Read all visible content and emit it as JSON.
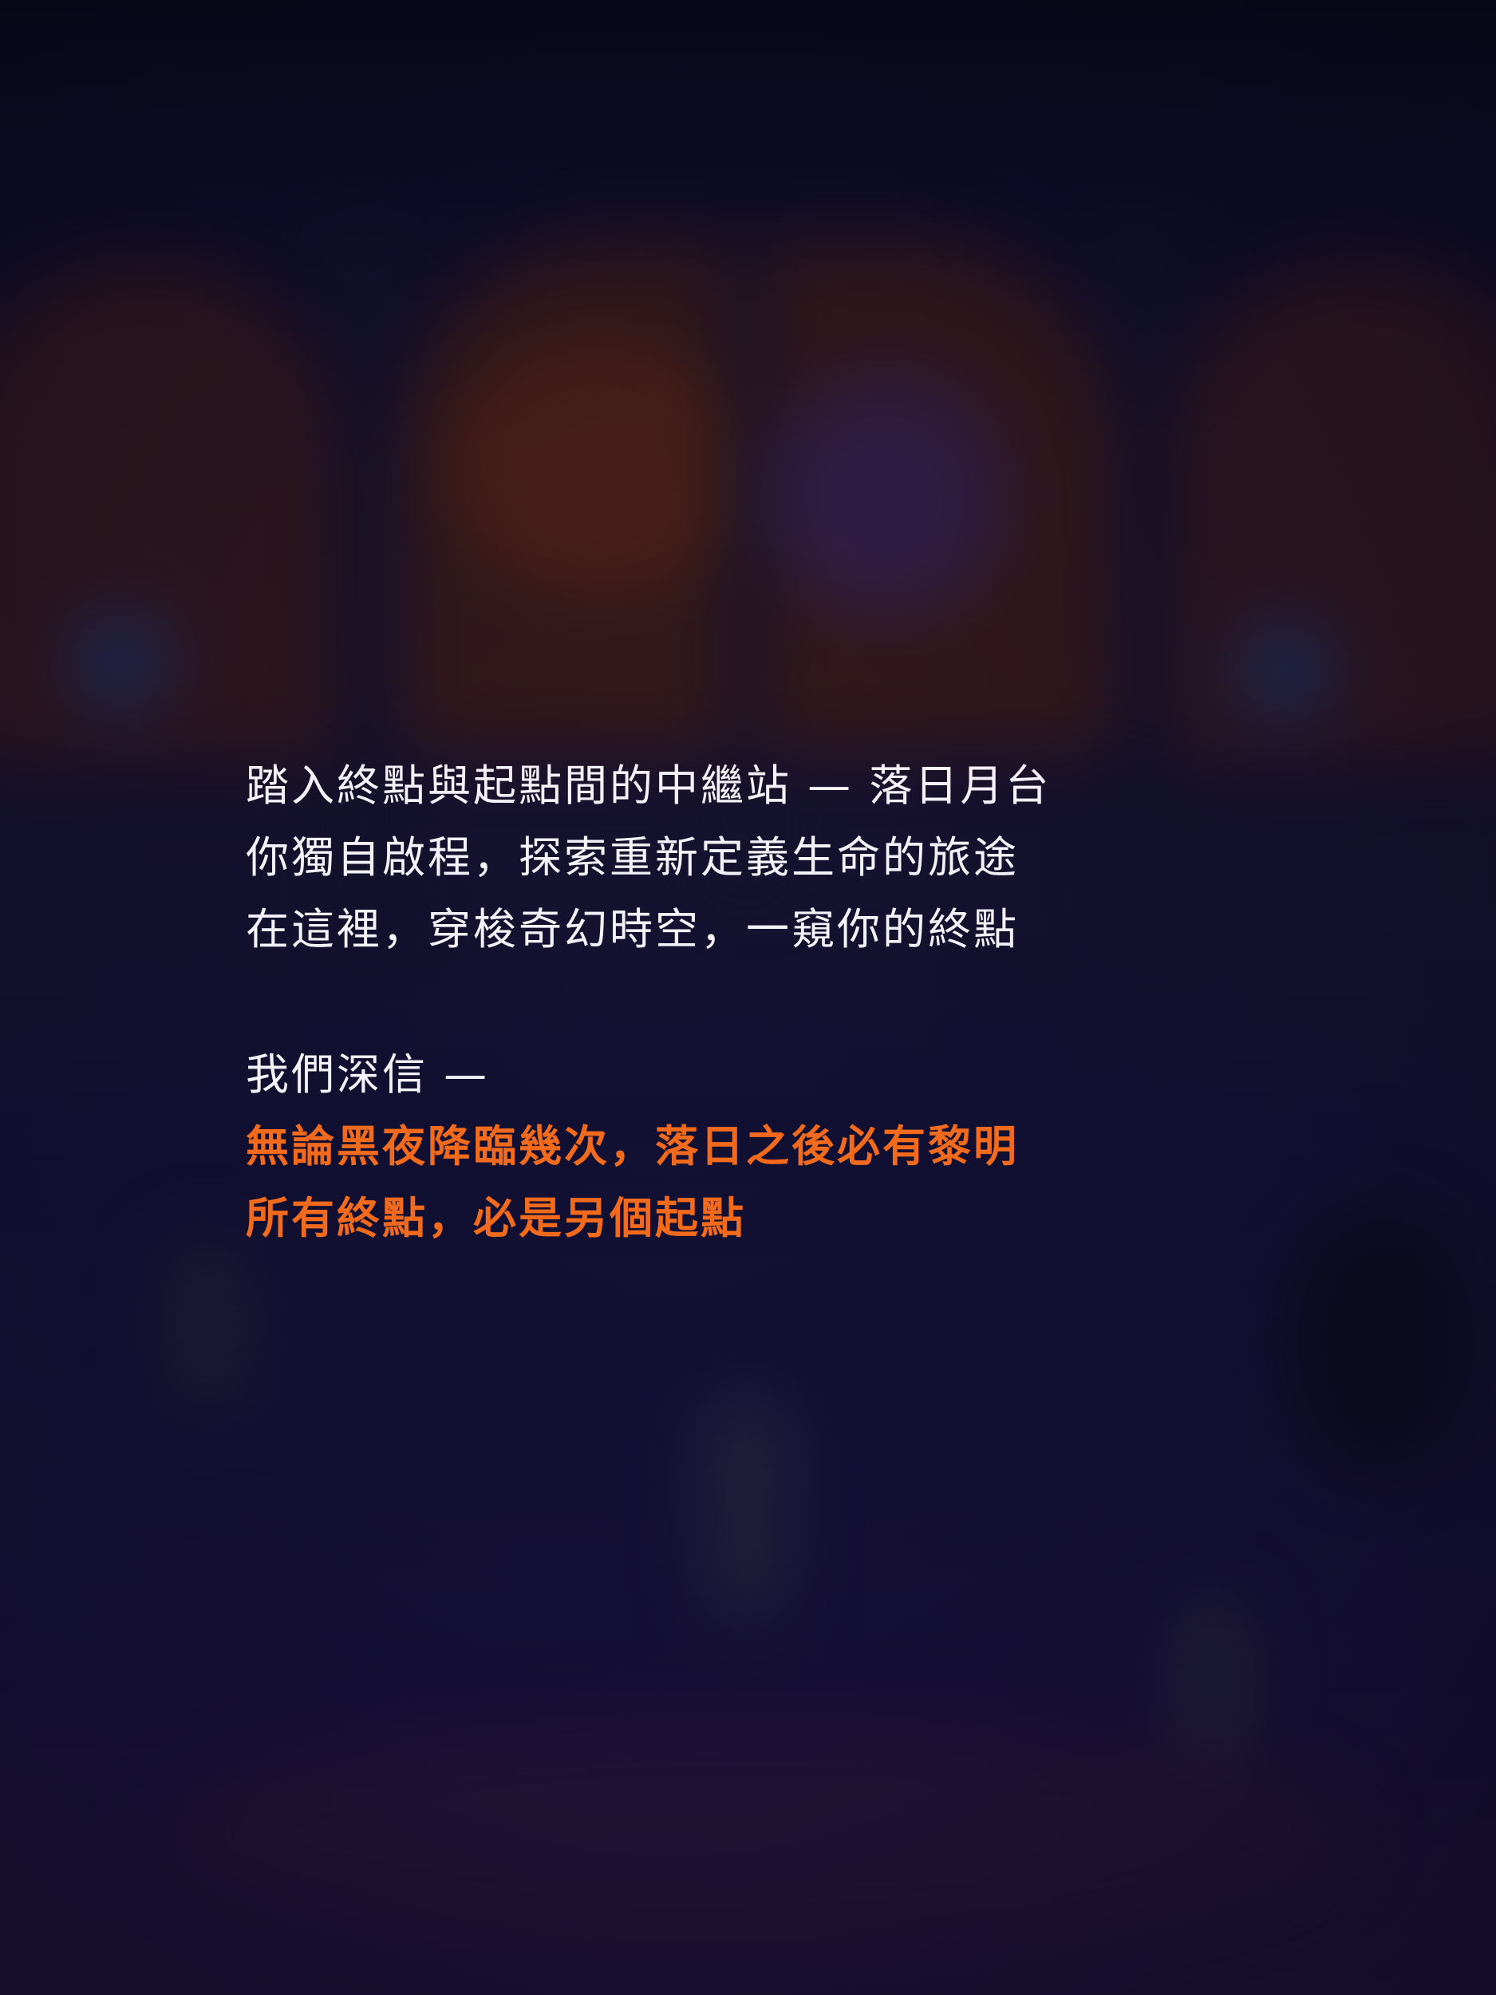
{
  "intro": {
    "lines": [
      "踏入終點與起點間的中繼站 — 落日月台",
      "你獨自啟程，探索重新定義生命的旅途",
      "在這裡，穿梭奇幻時空，一窺你的終點"
    ]
  },
  "belief": {
    "lead": "我們深信 —",
    "highlight_lines": [
      "無論黑夜降臨幾次，落日之後必有黎明",
      "所有終點，必是另個起點"
    ]
  },
  "colors": {
    "text": "#f4f2f8",
    "accent": "#f26a1b",
    "background": "#141238"
  }
}
